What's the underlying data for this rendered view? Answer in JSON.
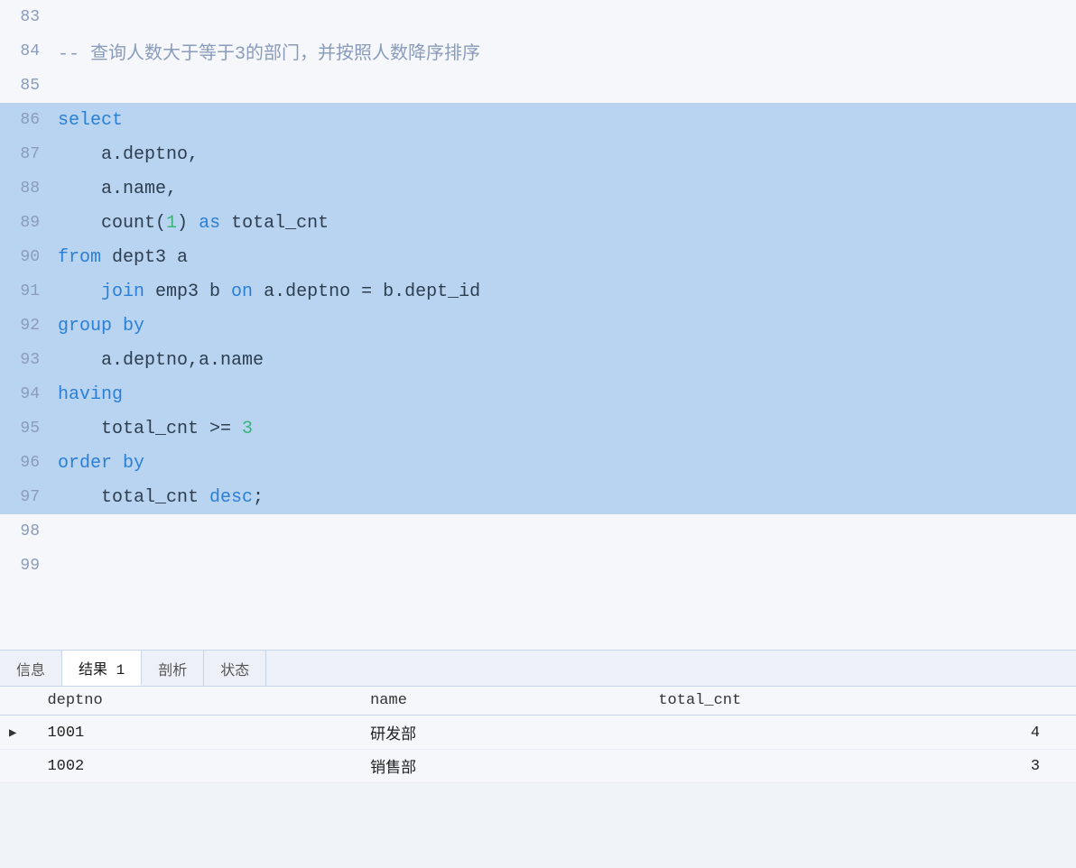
{
  "editor": {
    "lines": [
      {
        "number": "83",
        "content": "",
        "type": "empty"
      },
      {
        "number": "84",
        "content": "-- 查询人数大于等于3的部门，并按照人数降序排序",
        "type": "comment"
      },
      {
        "number": "85",
        "content": "",
        "type": "empty"
      },
      {
        "number": "86",
        "content": "select",
        "type": "selected",
        "tokens": [
          {
            "text": "select",
            "style": "kw-blue"
          }
        ]
      },
      {
        "number": "87",
        "content": "    a.deptno,",
        "type": "selected",
        "tokens": [
          {
            "text": "    a.deptno,",
            "style": "text-normal"
          }
        ]
      },
      {
        "number": "88",
        "content": "    a.name,",
        "type": "selected",
        "tokens": [
          {
            "text": "    a.name,",
            "style": "text-normal"
          }
        ]
      },
      {
        "number": "89",
        "content": "    count(1) as total_cnt",
        "type": "selected",
        "tokens": [
          {
            "text": "    count(",
            "style": "text-normal"
          },
          {
            "text": "1",
            "style": "kw-green"
          },
          {
            "text": ") ",
            "style": "text-normal"
          },
          {
            "text": "as",
            "style": "kw-blue"
          },
          {
            "text": " total_cnt",
            "style": "text-normal"
          }
        ]
      },
      {
        "number": "90",
        "content": "from dept3 a",
        "type": "selected",
        "tokens": [
          {
            "text": "from",
            "style": "kw-blue"
          },
          {
            "text": " dept3 a",
            "style": "text-normal"
          }
        ]
      },
      {
        "number": "91",
        "content": "    join emp3 b on a.deptno = b.dept_id",
        "type": "selected",
        "tokens": [
          {
            "text": "    ",
            "style": "text-normal"
          },
          {
            "text": "join",
            "style": "kw-blue"
          },
          {
            "text": " emp3 b ",
            "style": "text-normal"
          },
          {
            "text": "on",
            "style": "kw-blue"
          },
          {
            "text": " a.deptno = b.dept_id",
            "style": "text-normal"
          }
        ]
      },
      {
        "number": "92",
        "content": "group by",
        "type": "selected",
        "tokens": [
          {
            "text": "group",
            "style": "kw-blue"
          },
          {
            "text": " ",
            "style": "text-normal"
          },
          {
            "text": "by",
            "style": "kw-blue"
          }
        ]
      },
      {
        "number": "93",
        "content": "    a.deptno,a.name",
        "type": "selected",
        "tokens": [
          {
            "text": "    a.deptno,a.name",
            "style": "text-normal"
          }
        ]
      },
      {
        "number": "94",
        "content": "having",
        "type": "selected",
        "tokens": [
          {
            "text": "having",
            "style": "kw-blue"
          }
        ]
      },
      {
        "number": "95",
        "content": "    total_cnt >= 3",
        "type": "selected",
        "tokens": [
          {
            "text": "    total_cnt >= ",
            "style": "text-normal"
          },
          {
            "text": "3",
            "style": "kw-green"
          }
        ]
      },
      {
        "number": "96",
        "content": "order by",
        "type": "selected",
        "tokens": [
          {
            "text": "order",
            "style": "kw-blue"
          },
          {
            "text": " ",
            "style": "text-normal"
          },
          {
            "text": "by",
            "style": "kw-blue"
          }
        ]
      },
      {
        "number": "97",
        "content": "    total_cnt desc;",
        "type": "selected",
        "tokens": [
          {
            "text": "    total_cnt ",
            "style": "text-normal"
          },
          {
            "text": "desc",
            "style": "kw-blue"
          },
          {
            "text": ";",
            "style": "text-normal"
          }
        ]
      },
      {
        "number": "98",
        "content": "",
        "type": "empty"
      },
      {
        "number": "99",
        "content": "",
        "type": "empty"
      }
    ]
  },
  "tabs": [
    {
      "label": "信息",
      "active": false
    },
    {
      "label": "结果 1",
      "active": true
    },
    {
      "label": "剖析",
      "active": false
    },
    {
      "label": "状态",
      "active": false
    }
  ],
  "table": {
    "columns": [
      "",
      "deptno",
      "name",
      "total_cnt"
    ],
    "rows": [
      {
        "indicator": "▶",
        "deptno": "1001",
        "name": "研发部",
        "total_cnt": "4"
      },
      {
        "indicator": "",
        "deptno": "1002",
        "name": "销售部",
        "total_cnt": "3"
      }
    ]
  }
}
